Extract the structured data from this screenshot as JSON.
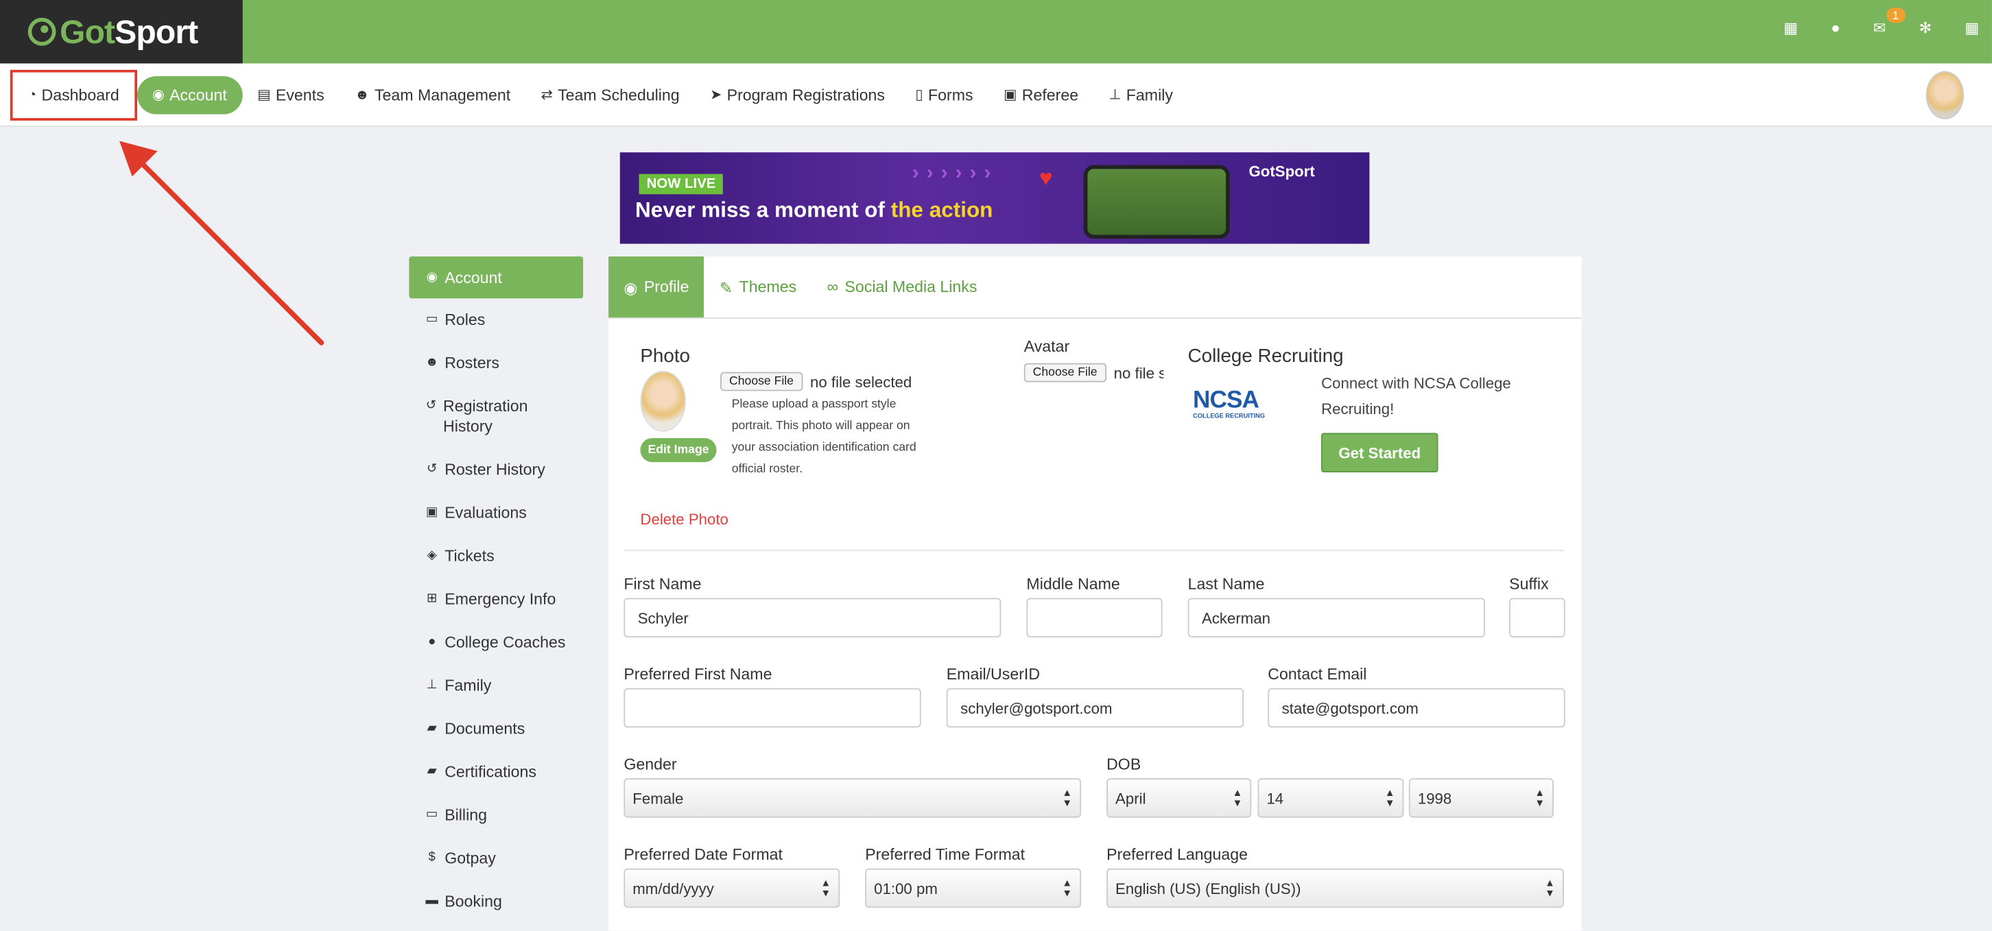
{
  "brand": {
    "logo_g": "Got",
    "logo_s": "Sport"
  },
  "topbar": {
    "mail_badge": "1"
  },
  "nav": {
    "items": [
      {
        "icon": "dashboard-icon",
        "label": "Dashboard"
      },
      {
        "icon": "user-circle-icon",
        "label": "Account"
      },
      {
        "icon": "calendar-icon",
        "label": "Events"
      },
      {
        "icon": "users-icon",
        "label": "Team Management"
      },
      {
        "icon": "exchange-icon",
        "label": "Team Scheduling"
      },
      {
        "icon": "paper-plane-icon",
        "label": "Program Registrations"
      },
      {
        "icon": "file-icon",
        "label": "Forms"
      },
      {
        "icon": "calendar-check-icon",
        "label": "Referee"
      },
      {
        "icon": "sitemap-icon",
        "label": "Family"
      }
    ]
  },
  "banner": {
    "badge": "NOW LIVE",
    "headline_a": "Never miss a moment of ",
    "headline_b": "the action",
    "brand": "GotSport"
  },
  "sidebar": {
    "items": [
      {
        "label": "Account"
      },
      {
        "label": "Roles"
      },
      {
        "label": "Rosters"
      },
      {
        "label": "Registration History"
      },
      {
        "label": "Roster History"
      },
      {
        "label": "Evaluations"
      },
      {
        "label": "Tickets"
      },
      {
        "label": "Emergency Info"
      },
      {
        "label": "College Coaches"
      },
      {
        "label": "Family"
      },
      {
        "label": "Documents"
      },
      {
        "label": "Certifications"
      },
      {
        "label": "Billing"
      },
      {
        "label": "Gotpay"
      },
      {
        "label": "Booking"
      }
    ]
  },
  "tabs": [
    {
      "label": "Profile"
    },
    {
      "label": "Themes"
    },
    {
      "label": "Social Media Links"
    }
  ],
  "photo": {
    "title": "Photo",
    "choose": "Choose File",
    "no_file": "no file selected",
    "help": "Please upload a passport style portrait. This photo will appear on your association identification card official roster.",
    "edit": "Edit Image",
    "delete": "Delete Photo"
  },
  "avatar": {
    "title": "Avatar",
    "choose": "Choose File",
    "no_file": "no file s"
  },
  "recruiting": {
    "title": "College Recruiting",
    "logo": "NCSA",
    "logo_sub": "COLLEGE RECRUITING",
    "text": "Connect with NCSA College Recruiting!",
    "button": "Get Started"
  },
  "form": {
    "first_name": {
      "label": "First Name",
      "value": "Schyler"
    },
    "middle_name": {
      "label": "Middle Name",
      "value": ""
    },
    "last_name": {
      "label": "Last Name",
      "value": "Ackerman"
    },
    "suffix": {
      "label": "Suffix",
      "value": ""
    },
    "preferred_first": {
      "label": "Preferred First Name",
      "value": ""
    },
    "email": {
      "label": "Email/UserID",
      "value": "schyler@gotsport.com"
    },
    "contact_email": {
      "label": "Contact Email",
      "value": "state@gotsport.com"
    },
    "gender": {
      "label": "Gender",
      "value": "Female"
    },
    "dob": {
      "label": "DOB",
      "month": "April",
      "day": "14",
      "year": "1998"
    },
    "date_format": {
      "label": "Preferred Date Format",
      "value": "mm/dd/yyyy"
    },
    "time_format": {
      "label": "Preferred Time Format",
      "value": "01:00 pm"
    },
    "language": {
      "label": "Preferred Language",
      "value": "English (US) (English (US))"
    }
  },
  "colors": {
    "brand_green": "#7ab55c",
    "dark": "#2b2b2b",
    "annotation_red": "#e03a2a"
  }
}
